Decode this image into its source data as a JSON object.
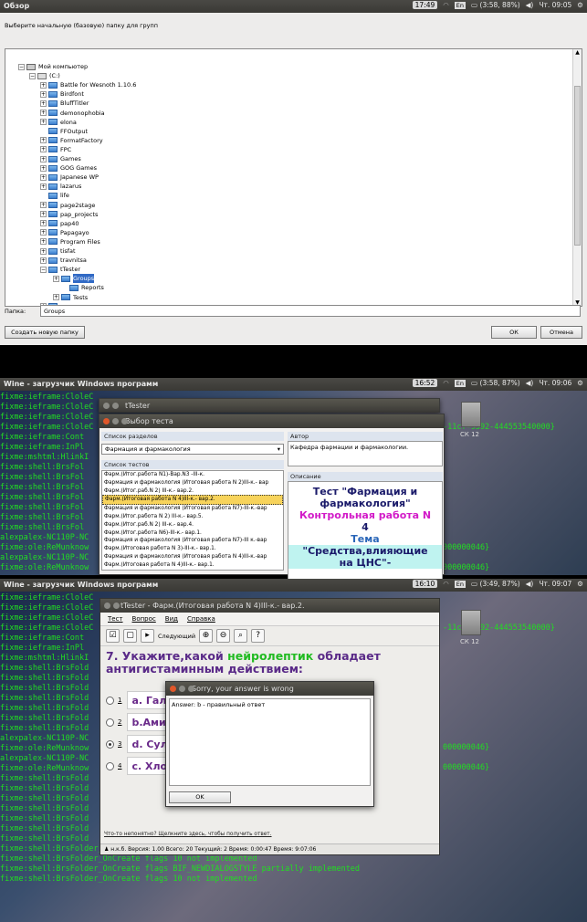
{
  "panel1": {
    "topbar": {
      "title": "Обзор",
      "clock": "17:49",
      "lang": "En",
      "battery": "(3:58, 88%)",
      "datetime": "Чт. 09:05"
    },
    "prompt": "Выберите начальную (базовую) папку для групп",
    "tree": {
      "root": "Мой компьютер",
      "drive": "(C:)",
      "folders": [
        "Battle for Wesnoth 1.10.6",
        "Birdfont",
        "BluffTitler",
        "demonophobia",
        "elona",
        "FFOutput",
        "FormatFactory",
        "FPC",
        "Games",
        "GOG Games",
        "Japanese WP",
        "lazarus",
        "life",
        "page2stage",
        "pap_projects",
        "pap40",
        "Papagayo",
        "Program Files",
        "tisfat",
        "travnitsa",
        "tTester"
      ],
      "subfolders": [
        "Groups",
        "Reports",
        "Tests"
      ],
      "last": "users"
    },
    "folder_label": "Папка:",
    "folder_value": "Groups",
    "new_folder_button": "Создать новую папку",
    "ok_button": "ОК",
    "cancel_button": "Отмена"
  },
  "panel2": {
    "topbar": {
      "title": "Wine - загрузчик Windows программ",
      "clock": "16:52",
      "lang": "En",
      "battery": "(3:58, 87%)",
      "datetime": "Чт. 09:06"
    },
    "terminal": [
      "fixme:ieframe:CloleC",
      "fixme:ieframe:CloleC",
      "fixme:ieframe:CloleC",
      "fixme:ieframe:CloleC",
      "fixme:ieframe:Cont",
      "fixme:ieframe:InPl",
      "fixme:mshtml:HlinkI",
      "fixme:shell:BrsFol",
      "fixme:shell:BrsFol",
      "fixme:shell:BrsFol",
      "fixme:shell:BrsFol",
      "fixme:shell:BrsFol",
      "fixme:shell:BrsFol",
      "fixme:shell:BrsFol",
      "alexpalex-NC110P-NC",
      "fixme:ole:ReMunknow",
      "alexpalex-NC110P-NC",
      "fixme:ole:ReMunknow"
    ],
    "terminal_right": [
      "-11cf-9592-444553540000}",
      "000000046}",
      "000000046}"
    ],
    "bg_title": "tTester",
    "dialog_title": "Выбор теста",
    "sections_label": "Список разделов",
    "section_value": "Фармация и фармакология",
    "tests_label": "Список тестов",
    "tests": [
      "Фарм.(Итог.работа N1)-Вар.N3 -III-к.",
      "Фармация и фармакология (Итоговая работа N 2)III-к.- вар",
      "Фарм.(Итог.раб.N 2) III-к.- вар.2.",
      "Фарм.(Итоговая работа N 4)III-к.- вар.2.",
      "Фармация и фармакология (Итоговая работа N7)-III-к.-вар",
      "Фарм.(Итог.работа N 2) III-к.- вар.5.",
      "Фарм.(Итог.раб.N 2) III-к.- вар.4.",
      "Фарм.(Итог.работа N6)-III-к.- вар.1.",
      "Фармация и фармакология (Итоговая работа N7)-III к.-вар",
      "Фарм.(Итоговая работа N 3)-III-к.- вар.1.",
      "Фармация и фармакология (Итоговая работа N 4)III-к.-вар",
      "Фарм.(Итоговая работа N 4)III-к.- вар.1.",
      "Фарм.(Итоговая работа N7)-III-к.- вар.1."
    ],
    "selected_index": 3,
    "author_label": "Автор",
    "author_value": "Кафедра фармации и фармакологии.",
    "desc_label": "Описание",
    "desc_lines": [
      "Тест \"Фармация и",
      "фармакология\"",
      "Контрольная работа N",
      "4",
      "Тема",
      "\"Средства,влияющие",
      "на ЦНС\"-"
    ],
    "desktop_icon_label": "СК 12"
  },
  "panel3": {
    "topbar": {
      "title": "Wine - загрузчик Windows программ",
      "clock": "16:10",
      "lang": "En",
      "battery": "(3:49, 87%)",
      "datetime": "Чт. 09:07"
    },
    "terminal": [
      "fixme:ieframe:CloleC",
      "fixme:ieframe:CloleC",
      "fixme:ieframe:CloleC",
      "fixme:ieframe:CloleC",
      "fixme:ieframe:Cont",
      "fixme:ieframe:InPl",
      "fixme:mshtml:HlinkI",
      "fixme:shell:BrsFold",
      "fixme:shell:BrsFold",
      "fixme:shell:BrsFold",
      "fixme:shell:BrsFold",
      "fixme:shell:BrsFold",
      "fixme:shell:BrsFold",
      "fixme:shell:BrsFold",
      "alexpalex-NC110P-NC",
      "fixme:ole:ReMunknow",
      "alexpalex-NC110P-NC",
      "fixme:ole:ReMunknow",
      "fixme:shell:BrsFold",
      "fixme:shell:BrsFold",
      "fixme:shell:BrsFold",
      "fixme:shell:BrsFold",
      "fixme:shell:BrsFold",
      "fixme:shell:BrsFold",
      "fixme:shell:BrsFold",
      "fixme:shell:BrsFolder_OnCreate flags BIF_NEWDIALOGSTYLE partially implemented",
      "fixme:shell:BrsFolder_OnCreate flags 10 not implemented",
      "fixme:shell:BrsFolder_OnCreate flags BIF_NEWDIALOGSTYLE partially implemented",
      "fixme:shell:BrsFolder_OnCreate flags 10 not implemented"
    ],
    "terminal_right": [
      "-11cf-9592-444553540000}",
      "000000046}",
      "000000046}"
    ],
    "app_title": "tTester - Фарм.(Итоговая работа N 4)III-к.- вар.2.",
    "menu": [
      "Тест",
      "Вопрос",
      "Вид",
      "Справка"
    ],
    "next_button": "Следующий",
    "question_prefix": "7. Укажите,какой ",
    "question_highlight": "нейролептик",
    "question_suffix": " обладает антигистаминным действием:",
    "answers": [
      {
        "num": "1",
        "text": "а. Гал"
      },
      {
        "num": "2",
        "text": "b.Ами"
      },
      {
        "num": "3",
        "text": "d. Сул"
      },
      {
        "num": "4",
        "text": "с. Хло"
      }
    ],
    "checked_index": 2,
    "help_link": "Что-то непонятно? Щелкните здесь, чтобы получить ответ.",
    "status": "н.к.б.  Версия: 1.00  Всего: 20  Текущий: 2   Время: 0:00:47  Время: 9:07:06",
    "popup_title": "Sorry, your answer is wrong",
    "popup_text": "Answer: b - правильный ответ",
    "popup_ok": "OK",
    "desktop_icon_label": "СК 12"
  }
}
